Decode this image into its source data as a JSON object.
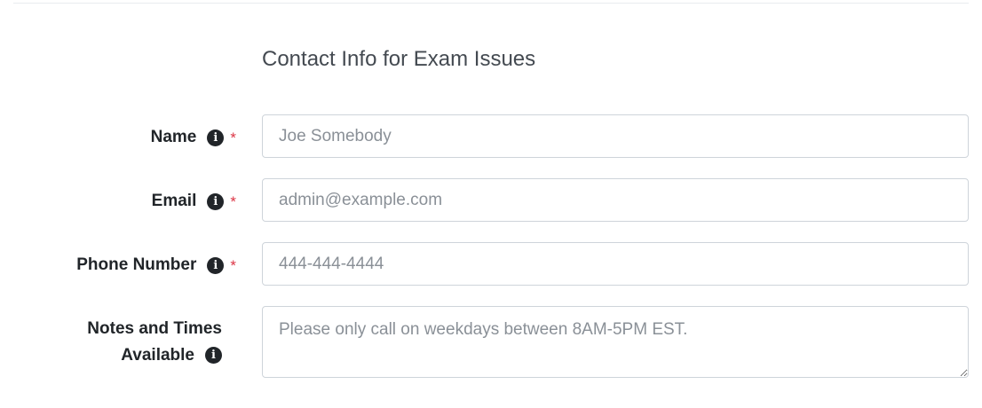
{
  "form": {
    "title": "Contact Info for Exam Issues",
    "fields": [
      {
        "label": "Name",
        "required_mark": "*",
        "placeholder": "Joe Somebody"
      },
      {
        "label": "Email",
        "required_mark": "*",
        "placeholder": "admin@example.com"
      },
      {
        "label": "Phone Number",
        "required_mark": "*",
        "placeholder": "444-444-4444"
      },
      {
        "label_line1": "Notes and Times",
        "label_line2": "Available",
        "placeholder": "Please only call on weekdays between 8AM-5PM EST."
      }
    ]
  },
  "icons": {
    "info": "info-circle-icon"
  },
  "colors": {
    "required": "#dc3545",
    "border": "#ced4da",
    "placeholder": "#8a9097"
  }
}
